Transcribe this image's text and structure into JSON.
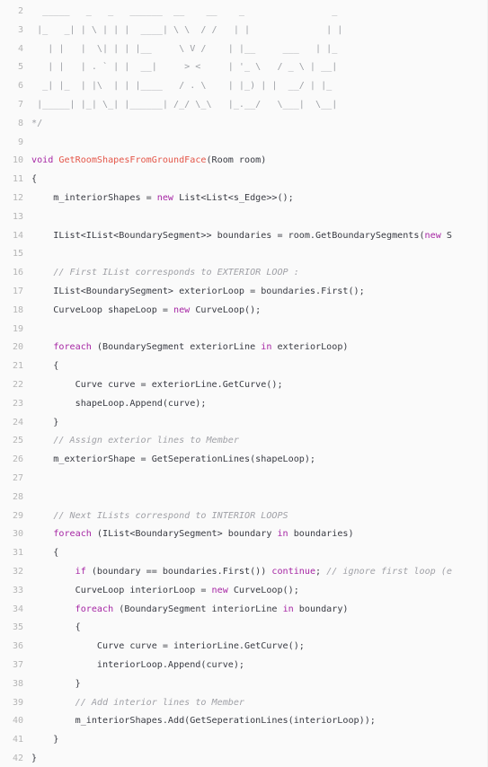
{
  "colors": {
    "background": "#fafafa",
    "line_number": "#b5b5b5",
    "text": "#383a42",
    "keyword": "#a626a4",
    "method_name": "#e45649",
    "comment": "#a0a1a7"
  },
  "lines": [
    {
      "number": "2",
      "tokens": [
        {
          "t": "  _____   _   _   ______  __    __    _                _",
          "k": "ascii"
        }
      ]
    },
    {
      "number": "3",
      "tokens": [
        {
          "t": " |_   _| | \\ | | |  ____| \\ \\  / /   | |              | |",
          "k": "ascii"
        }
      ]
    },
    {
      "number": "4",
      "tokens": [
        {
          "t": "   | |   |  \\| | | |__     \\ V /    | |__     ___   | |_",
          "k": "ascii"
        }
      ]
    },
    {
      "number": "5",
      "tokens": [
        {
          "t": "   | |   | . ` | |  __|     > <     | '_ \\   / _ \\ | __|",
          "k": "ascii"
        }
      ]
    },
    {
      "number": "6",
      "tokens": [
        {
          "t": "  _| |_  | |\\  | | |____   / . \\    | |_) | |  __/ | |_",
          "k": "ascii"
        }
      ]
    },
    {
      "number": "7",
      "tokens": [
        {
          "t": " |_____| |_| \\_| |______| /_/ \\_\\   |_.__/   \\___|  \\__|",
          "k": "ascii"
        }
      ]
    },
    {
      "number": "8",
      "tokens": [
        {
          "t": "*/",
          "k": "ascii"
        }
      ]
    },
    {
      "number": "9",
      "tokens": []
    },
    {
      "number": "10",
      "tokens": [
        {
          "t": "void ",
          "k": "keyword"
        },
        {
          "t": "GetRoomShapesFromGroundFace",
          "k": "method"
        },
        {
          "t": "(Room room)",
          "k": "plain"
        }
      ]
    },
    {
      "number": "11",
      "tokens": [
        {
          "t": "{",
          "k": "plain"
        }
      ]
    },
    {
      "number": "12",
      "tokens": [
        {
          "t": "    m_interiorShapes = ",
          "k": "plain"
        },
        {
          "t": "new",
          "k": "keyword"
        },
        {
          "t": " List<List<s_Edge>>();",
          "k": "plain"
        }
      ]
    },
    {
      "number": "13",
      "tokens": []
    },
    {
      "number": "14",
      "tokens": [
        {
          "t": "    IList<IList<BoundarySegment>> boundaries = room.GetBoundarySegments(",
          "k": "plain"
        },
        {
          "t": "new",
          "k": "keyword"
        },
        {
          "t": " S",
          "k": "plain"
        }
      ]
    },
    {
      "number": "15",
      "tokens": []
    },
    {
      "number": "16",
      "tokens": [
        {
          "t": "    ",
          "k": "plain"
        },
        {
          "t": "// First IList corresponds to EXTERIOR LOOP :",
          "k": "comment"
        }
      ]
    },
    {
      "number": "17",
      "tokens": [
        {
          "t": "    IList<BoundarySegment> exteriorLoop = boundaries.First();",
          "k": "plain"
        }
      ]
    },
    {
      "number": "18",
      "tokens": [
        {
          "t": "    CurveLoop shapeLoop = ",
          "k": "plain"
        },
        {
          "t": "new",
          "k": "keyword"
        },
        {
          "t": " CurveLoop();",
          "k": "plain"
        }
      ]
    },
    {
      "number": "19",
      "tokens": []
    },
    {
      "number": "20",
      "tokens": [
        {
          "t": "    ",
          "k": "plain"
        },
        {
          "t": "foreach",
          "k": "keyword"
        },
        {
          "t": " (BoundarySegment exteriorLine ",
          "k": "plain"
        },
        {
          "t": "in",
          "k": "keyword"
        },
        {
          "t": " exteriorLoop)",
          "k": "plain"
        }
      ]
    },
    {
      "number": "21",
      "tokens": [
        {
          "t": "    {",
          "k": "plain"
        }
      ]
    },
    {
      "number": "22",
      "tokens": [
        {
          "t": "        Curve curve = exteriorLine.GetCurve();",
          "k": "plain"
        }
      ]
    },
    {
      "number": "23",
      "tokens": [
        {
          "t": "        shapeLoop.Append(curve);",
          "k": "plain"
        }
      ]
    },
    {
      "number": "24",
      "tokens": [
        {
          "t": "    }",
          "k": "plain"
        }
      ]
    },
    {
      "number": "25",
      "tokens": [
        {
          "t": "    ",
          "k": "plain"
        },
        {
          "t": "// Assign exterior lines to Member",
          "k": "comment"
        }
      ]
    },
    {
      "number": "26",
      "tokens": [
        {
          "t": "    m_exteriorShape = GetSeperationLines(shapeLoop);",
          "k": "plain"
        }
      ]
    },
    {
      "number": "27",
      "tokens": []
    },
    {
      "number": "28",
      "tokens": []
    },
    {
      "number": "29",
      "tokens": [
        {
          "t": "    ",
          "k": "plain"
        },
        {
          "t": "// Next ILists correspond to INTERIOR LOOPS",
          "k": "comment"
        }
      ]
    },
    {
      "number": "30",
      "tokens": [
        {
          "t": "    ",
          "k": "plain"
        },
        {
          "t": "foreach",
          "k": "keyword"
        },
        {
          "t": " (IList<BoundarySegment> boundary ",
          "k": "plain"
        },
        {
          "t": "in",
          "k": "keyword"
        },
        {
          "t": " boundaries)",
          "k": "plain"
        }
      ]
    },
    {
      "number": "31",
      "tokens": [
        {
          "t": "    {",
          "k": "plain"
        }
      ]
    },
    {
      "number": "32",
      "tokens": [
        {
          "t": "        ",
          "k": "plain"
        },
        {
          "t": "if",
          "k": "keyword"
        },
        {
          "t": " (boundary == boundaries.First()) ",
          "k": "plain"
        },
        {
          "t": "continue",
          "k": "keyword"
        },
        {
          "t": "; ",
          "k": "plain"
        },
        {
          "t": "// ignore first loop (e",
          "k": "comment"
        }
      ]
    },
    {
      "number": "33",
      "tokens": [
        {
          "t": "        CurveLoop interiorLoop = ",
          "k": "plain"
        },
        {
          "t": "new",
          "k": "keyword"
        },
        {
          "t": " CurveLoop();",
          "k": "plain"
        }
      ]
    },
    {
      "number": "34",
      "tokens": [
        {
          "t": "        ",
          "k": "plain"
        },
        {
          "t": "foreach",
          "k": "keyword"
        },
        {
          "t": " (BoundarySegment interiorLine ",
          "k": "plain"
        },
        {
          "t": "in",
          "k": "keyword"
        },
        {
          "t": " boundary)",
          "k": "plain"
        }
      ]
    },
    {
      "number": "35",
      "tokens": [
        {
          "t": "        {",
          "k": "plain"
        }
      ]
    },
    {
      "number": "36",
      "tokens": [
        {
          "t": "            Curve curve = interiorLine.GetCurve();",
          "k": "plain"
        }
      ]
    },
    {
      "number": "37",
      "tokens": [
        {
          "t": "            interiorLoop.Append(curve);",
          "k": "plain"
        }
      ]
    },
    {
      "number": "38",
      "tokens": [
        {
          "t": "        }",
          "k": "plain"
        }
      ]
    },
    {
      "number": "39",
      "tokens": [
        {
          "t": "        ",
          "k": "plain"
        },
        {
          "t": "// Add interior lines to Member",
          "k": "comment"
        }
      ]
    },
    {
      "number": "40",
      "tokens": [
        {
          "t": "        m_interiorShapes.Add(GetSeperationLines(interiorLoop));",
          "k": "plain"
        }
      ]
    },
    {
      "number": "41",
      "tokens": [
        {
          "t": "    }",
          "k": "plain"
        }
      ]
    },
    {
      "number": "42",
      "tokens": [
        {
          "t": "}",
          "k": "plain"
        }
      ]
    }
  ]
}
